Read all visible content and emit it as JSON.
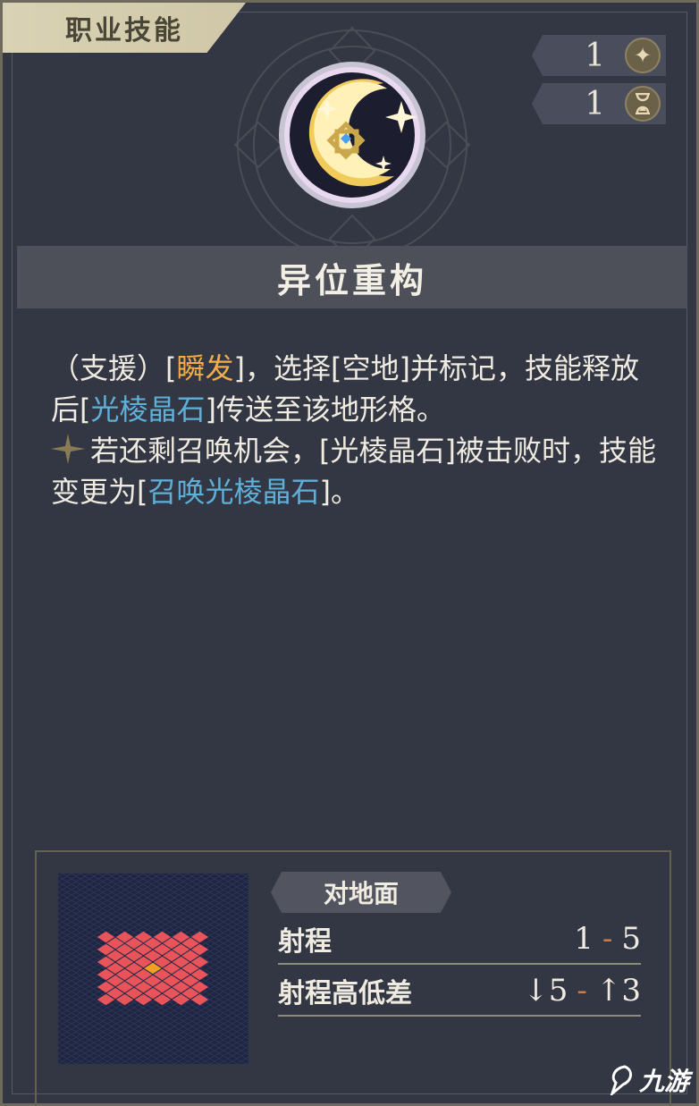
{
  "card": {
    "category": "职业技能",
    "skill_name": "异位重构",
    "cost": {
      "value": "1",
      "icon": "sparkle-icon"
    },
    "cooldown": {
      "value": "1",
      "icon": "hourglass-icon"
    }
  },
  "description": {
    "line1_prefix": "（支援）[",
    "instant": "瞬发",
    "line1_mid": "]，选择[空地]并标记，技能释放后[",
    "crystal": "光棱晶石",
    "line1_suffix": "]传送至该地形格。",
    "line2_prefix": "若还剩召唤机会，[光棱晶石]被击败时，技能变更为[",
    "summon_crystal": "召唤光棱晶石",
    "line2_suffix": "]。"
  },
  "range_panel": {
    "target_type": "对地面",
    "range_label": "射程",
    "range_min": "1",
    "range_max": "5",
    "height_label": "射程高低差",
    "height_down": "5",
    "height_up": "3"
  },
  "watermark": {
    "text": "九游"
  },
  "colors": {
    "accent_orange": "#f0ae4a",
    "accent_blue": "#5fb0d8",
    "tile_red": "#e8545a",
    "tile_center": "#f0a020"
  }
}
